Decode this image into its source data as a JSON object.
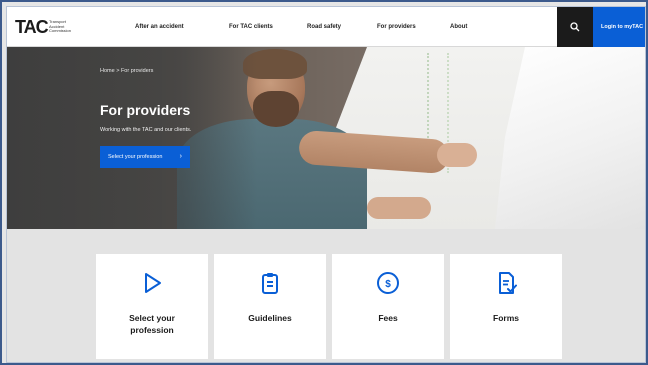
{
  "header": {
    "logo_mark": "TAC",
    "logo_tagline": "Transport Accident Commission",
    "nav": [
      {
        "label": "After an accident"
      },
      {
        "label": "For TAC clients"
      },
      {
        "label": "Road safety"
      },
      {
        "label": "For providers"
      },
      {
        "label": "About"
      }
    ],
    "search_icon": "search-icon",
    "login_label": "Login to myTAC"
  },
  "hero": {
    "breadcrumb": "Home  >  For providers",
    "title": "For providers",
    "subtitle": "Working with the TAC and our clients.",
    "cta_label": "Select your profession",
    "cta_icon": "chevron-right-icon"
  },
  "cards": [
    {
      "label": "Select your profession",
      "icon": "play-triangle-icon"
    },
    {
      "label": "Guidelines",
      "icon": "clipboard-icon"
    },
    {
      "label": "Fees",
      "icon": "dollar-circle-icon"
    },
    {
      "label": "Forms",
      "icon": "document-check-icon"
    }
  ],
  "colors": {
    "accent": "#0a5fd6",
    "header_bg": "#ffffff",
    "search_bg": "#1b1b1b",
    "card_bg": "#ffffff",
    "page_bg": "#e3e3e3"
  }
}
